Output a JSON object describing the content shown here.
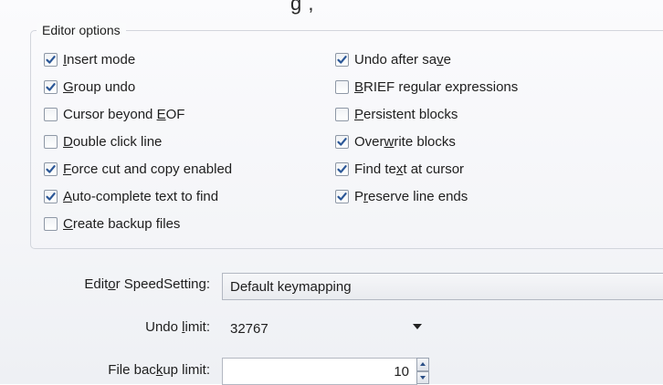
{
  "top_fragment": "g ,",
  "group": {
    "legend": "Editor options",
    "left_options": [
      {
        "pre": "",
        "key": "I",
        "post": "nsert mode",
        "checked": true
      },
      {
        "pre": "",
        "key": "G",
        "post": "roup undo",
        "checked": true
      },
      {
        "pre": "Cursor beyond ",
        "key": "E",
        "post": "OF",
        "checked": false
      },
      {
        "pre": "",
        "key": "D",
        "post": "ouble click line",
        "checked": false
      },
      {
        "pre": "",
        "key": "F",
        "post": "orce cut and copy enabled",
        "checked": true
      },
      {
        "pre": "",
        "key": "A",
        "post": "uto-complete text to find",
        "checked": true
      },
      {
        "pre": "",
        "key": "C",
        "post": "reate backup files",
        "checked": false
      }
    ],
    "right_options": [
      {
        "pre": "Undo after sa",
        "key": "v",
        "post": "e",
        "checked": true
      },
      {
        "pre": "",
        "key": "B",
        "post": "RIEF regular expressions",
        "checked": false
      },
      {
        "pre": "",
        "key": "P",
        "post": "ersistent blocks",
        "checked": false
      },
      {
        "pre": "Over",
        "key": "w",
        "post": "rite blocks",
        "checked": true
      },
      {
        "pre": "Find te",
        "key": "x",
        "post": "t at cursor",
        "checked": true
      },
      {
        "pre": "P",
        "key": "r",
        "post": "eserve line ends",
        "checked": true
      }
    ]
  },
  "speed_setting": {
    "label_pre": "Edit",
    "label_key": "o",
    "label_post": "r SpeedSetting:",
    "value": "Default keymapping"
  },
  "undo_limit": {
    "label_pre": "Undo ",
    "label_key": "l",
    "label_post": "imit:",
    "value": "32767"
  },
  "backup_limit": {
    "label_pre": "File bac",
    "label_key": "k",
    "label_post": "up limit:",
    "value": "10"
  },
  "colors": {
    "check": "#2b5797",
    "border": "#8e98a6"
  }
}
